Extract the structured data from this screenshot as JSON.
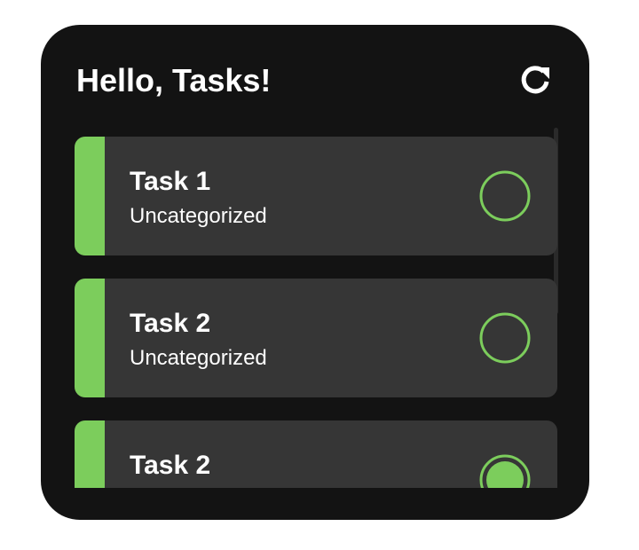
{
  "header": {
    "title": "Hello, Tasks!",
    "refresh_icon": "refresh-icon"
  },
  "tasks": [
    {
      "title": "Task 1",
      "category": "Uncategorized",
      "completed": false
    },
    {
      "title": "Task 2",
      "category": "Uncategorized",
      "completed": false
    },
    {
      "title": "Task 2",
      "category": "",
      "completed": true
    }
  ],
  "colors": {
    "accent": "#7ccd5c",
    "background": "#131313",
    "card": "#363636",
    "text": "#ffffff"
  }
}
